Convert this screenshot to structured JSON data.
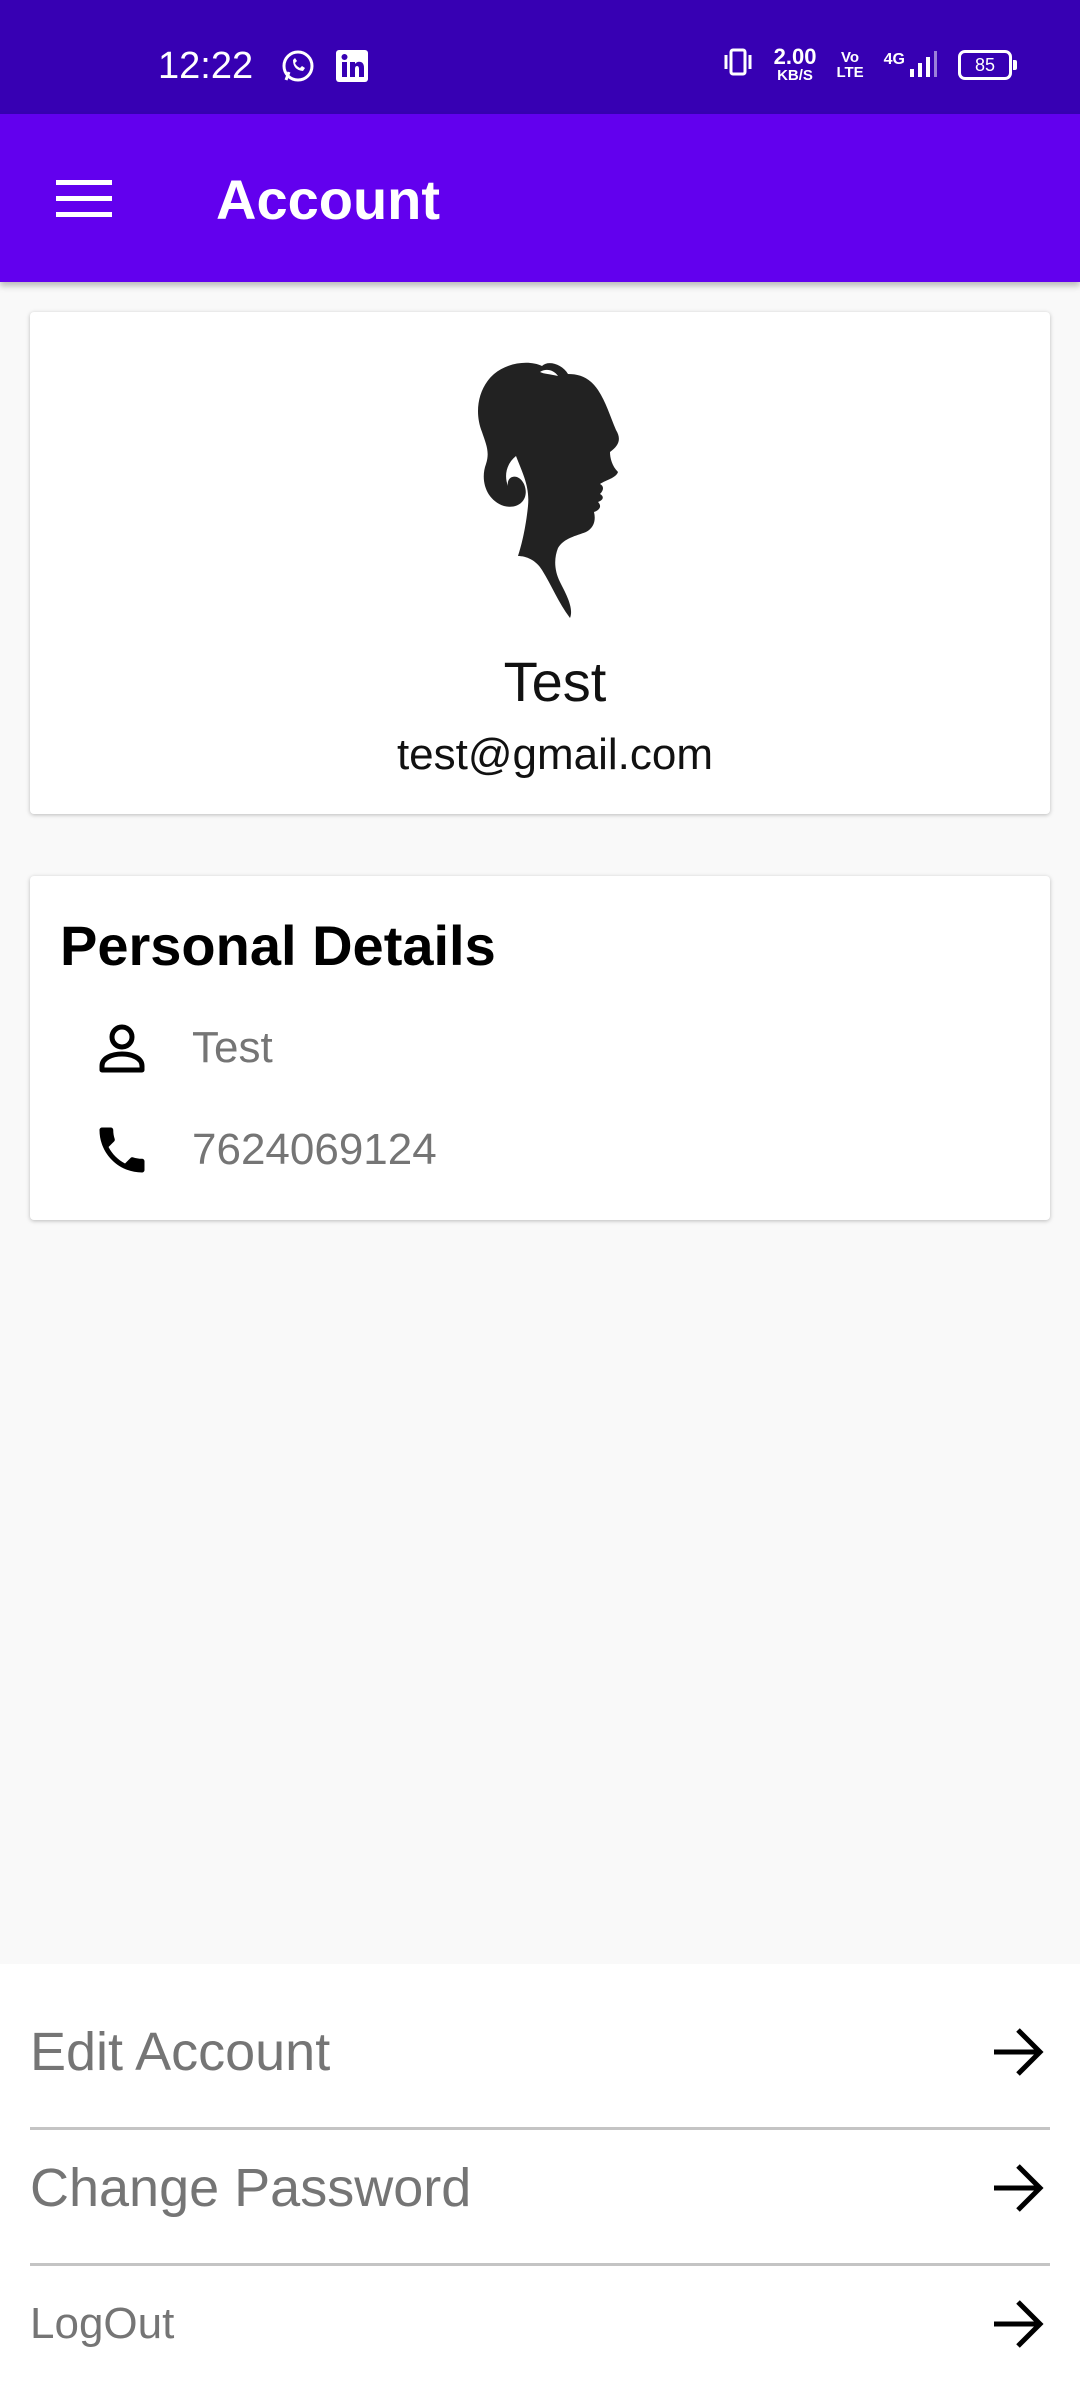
{
  "status_bar": {
    "time": "12:22",
    "app_icons": [
      "whatsapp-icon",
      "linkedin-icon"
    ],
    "network_speed": "2.00",
    "network_speed_unit": "KB/S",
    "volte_top": "Vo",
    "volte_bottom": "LTE",
    "network_type": "4G",
    "battery": "85",
    "background_color": "#3700b3"
  },
  "app_bar": {
    "title": "Account",
    "menu_icon": "hamburger-menu-icon",
    "background_color": "#6200ee"
  },
  "profile": {
    "avatar_icon": "woman-silhouette-avatar",
    "name": "Test",
    "email": "test@gmail.com"
  },
  "personal_details": {
    "title": "Personal Details",
    "rows": [
      {
        "icon": "person-icon",
        "value": "Test"
      },
      {
        "icon": "phone-icon",
        "value": "7624069124"
      }
    ]
  },
  "actions": [
    {
      "label": "Edit Account",
      "icon": "arrow-right-icon"
    },
    {
      "label": "Change Password",
      "icon": "arrow-right-icon"
    },
    {
      "label": "LogOut",
      "icon": "arrow-right-icon"
    }
  ]
}
